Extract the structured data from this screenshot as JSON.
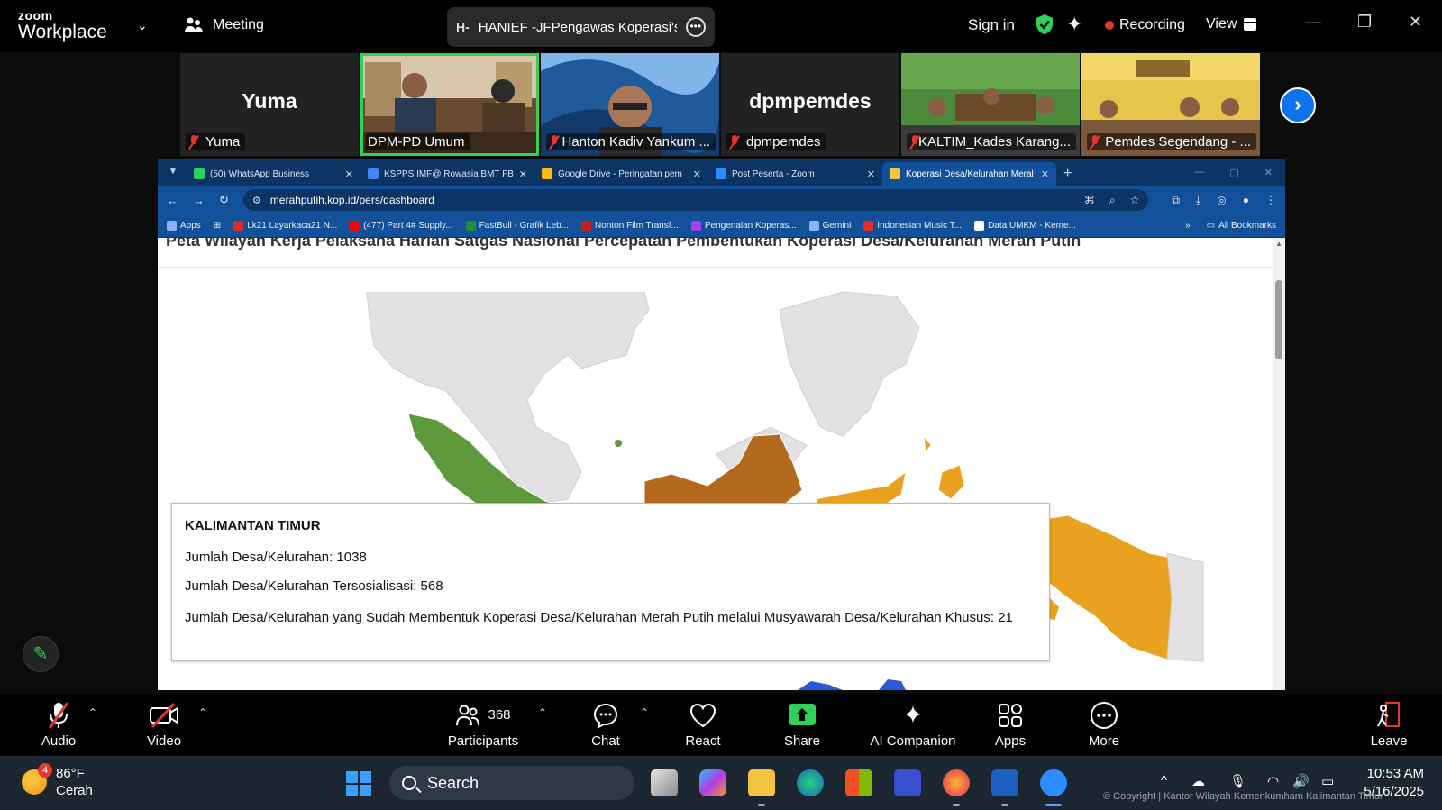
{
  "zoom": {
    "brand_top": "zoom",
    "brand_bottom": "Workplace",
    "meeting_label": "Meeting",
    "host_badge": "H-",
    "meeting_title": "HANIEF -JFPengawas Koperasi's s",
    "sign_in": "Sign in",
    "recording_label": "Recording",
    "view_label": "View",
    "colors": {
      "accent_green": "#2ed15a",
      "recording_red": "#e8342d",
      "zoom_blue": "#0e72ed"
    }
  },
  "participants": [
    {
      "name": "Yuma",
      "big_label": "Yuma",
      "has_video": false,
      "muted": true,
      "active": false
    },
    {
      "name": "DPM-PD Umum",
      "big_label": "",
      "has_video": true,
      "muted": false,
      "active": true
    },
    {
      "name": "Hanton Kadiv Yankum ...",
      "big_label": "",
      "has_video": true,
      "muted": true,
      "active": false
    },
    {
      "name": "dpmpemdes",
      "big_label": "dpmpemdes",
      "has_video": false,
      "muted": true,
      "active": false
    },
    {
      "name": "KALTIM_Kades Karang...",
      "big_label": "",
      "has_video": true,
      "muted": true,
      "active": false
    },
    {
      "name": "Pemdes Segendang - ...",
      "big_label": "",
      "has_video": true,
      "muted": true,
      "active": false
    }
  ],
  "browser": {
    "tabs": [
      {
        "label": "(50) WhatsApp Business",
        "fav_color": "#25d366",
        "selected": false
      },
      {
        "label": "KSPPS IMF@ Rowasia BMT FBB",
        "fav_color": "#4285f4",
        "selected": false
      },
      {
        "label": "Google Drive - Peringatan pem",
        "fav_color": "#fbbc04",
        "selected": false
      },
      {
        "label": "Post Peserta - Zoom",
        "fav_color": "#2d8cff",
        "selected": false
      },
      {
        "label": "Koperasi Desa/Kelurahan Meral",
        "fav_color": "#f5c542",
        "selected": true
      }
    ],
    "url": "merahputih.kop.id/pers/dashboard",
    "bookmarks": [
      {
        "label": "Apps",
        "color": "#8ab4f8"
      },
      {
        "label": "Lk21 Layarkaca21 N...",
        "color": "#d93025"
      },
      {
        "label": "(477) Part 4# Supply...",
        "color": "#ff0000"
      },
      {
        "label": "FastBull - Grafik Leb...",
        "color": "#1e8e3e"
      },
      {
        "label": "Nonton Film Transf...",
        "color": "#c5221f"
      },
      {
        "label": "Pengenalan Koperas...",
        "color": "#a142f4"
      },
      {
        "label": "Gemini",
        "color": "#8ab4f8"
      },
      {
        "label": "Indonesian Music T...",
        "color": "#e52d27"
      },
      {
        "label": "Data UMKM - Keme...",
        "color": "#ffffff"
      }
    ],
    "all_bookmarks": "All Bookmarks",
    "more_bookmarks": "»"
  },
  "page": {
    "title": "Peta Wilayah Kerja Pelaksana Harian Satgas Nasional Percepatan Pembentukan Koperasi Desa/Kelurahan Merah Putih",
    "map_colors": {
      "green": "#5e9a3c",
      "brown": "#b46a1e",
      "orange": "#e9a220",
      "gray": "#e2e2e4"
    },
    "tooltip": {
      "province": "KALIMANTAN TIMUR",
      "line1": "Jumlah Desa/Kelurahan: 1038",
      "line2": "Jumlah Desa/Kelurahan Tersosialisasi: 568",
      "line3": "Jumlah Desa/Kelurahan yang Sudah Membentuk Koperasi Desa/Kelurahan Merah Putih melalui Musyawarah Desa/Kelurahan Khusus: 21"
    }
  },
  "toolbar": {
    "audio": "Audio",
    "video": "Video",
    "participants": "Participants",
    "participants_count": "368",
    "chat": "Chat",
    "react": "React",
    "share": "Share",
    "ai_companion": "AI Companion",
    "apps": "Apps",
    "more": "More",
    "leave": "Leave"
  },
  "taskbar": {
    "temperature": "86°F",
    "weather": "Cerah",
    "notification_count": "4",
    "search_placeholder": "Search",
    "time": "10:53 AM",
    "date": "5/16/2025",
    "copyright": "© Copyright | Kantor Wilayah Kemenkumham Kalimantan Timur"
  }
}
